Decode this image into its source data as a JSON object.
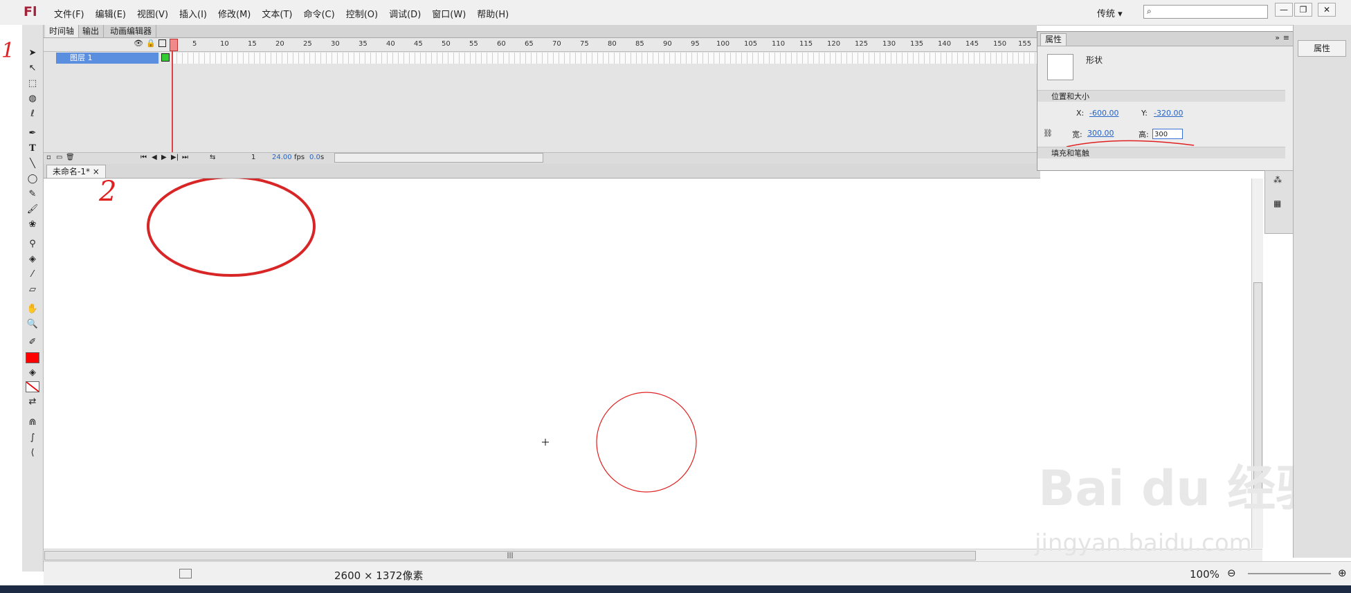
{
  "app": {
    "logo": "Fl",
    "menu": [
      "文件(F)",
      "编辑(E)",
      "视图(V)",
      "插入(I)",
      "修改(M)",
      "文本(T)",
      "命令(C)",
      "控制(O)",
      "调试(D)",
      "窗口(W)",
      "帮助(H)"
    ],
    "workspace": "传统",
    "window_buttons": [
      "—",
      "❐",
      "✕"
    ]
  },
  "timeline": {
    "tabs": [
      "时间轴",
      "输出",
      "动画编辑器"
    ],
    "ticks": [
      "1",
      "5",
      "10",
      "15",
      "20",
      "25",
      "30",
      "35",
      "40",
      "45",
      "50",
      "55",
      "60",
      "65",
      "70",
      "75",
      "80",
      "85",
      "90",
      "95",
      "100",
      "105",
      "110",
      "115",
      "120",
      "125",
      "130",
      "135",
      "140",
      "145",
      "150",
      "155"
    ],
    "layer_name": "图层 1",
    "frame": "1",
    "fps": "24.00",
    "fps_unit": "fps",
    "time": "0.0",
    "time_unit": "s"
  },
  "document": {
    "tab": "未命名-1*"
  },
  "properties": {
    "tab": "属性",
    "shape_label": "形状",
    "section_position": "位置和大小",
    "x_label": "X:",
    "x_value": "-600.00",
    "y_label": "Y:",
    "y_value": "-320.00",
    "w_label": "宽:",
    "w_value": "300.00",
    "h_label": "高:",
    "h_input": "300",
    "section_fill": "填充和笔触"
  },
  "dock": {
    "attr_label": "属性"
  },
  "status": {
    "dimensions": "2600 × 1372像素",
    "zoom": "100%"
  },
  "annotations": {
    "mark_1": "1",
    "mark_2": "2"
  },
  "watermark": {
    "brand": "Bai du 经验",
    "url": "jingyan.baidu.com"
  },
  "colors": {
    "accent": "#5a8ede",
    "stroke": "#e02020",
    "fill_swatch": "#ff0000"
  }
}
